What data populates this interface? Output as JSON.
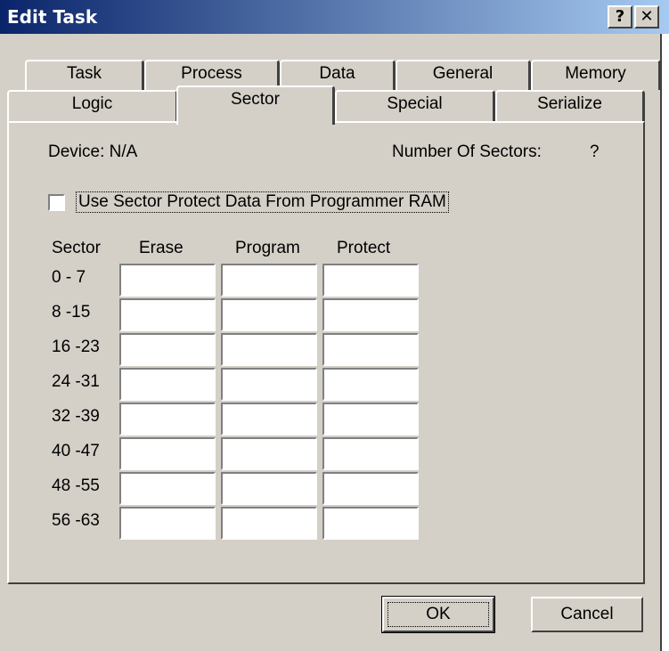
{
  "window": {
    "title": "Edit Task",
    "help_button": "?",
    "close_button": "✕",
    "title_gradient": [
      "#0a246a",
      "#a6caf0"
    ]
  },
  "tabs": {
    "row1": [
      "Task",
      "Process",
      "Data",
      "General",
      "Memory"
    ],
    "row2": [
      "Logic",
      "Sector",
      "Special",
      "Serialize"
    ],
    "active": "Sector"
  },
  "sector_panel": {
    "device_label": "Device: N/A",
    "num_sectors_label": "Number Of Sectors:",
    "num_sectors_value": "?",
    "use_protect_checkbox": {
      "label": "Use Sector Protect Data From Programmer RAM",
      "checked": false
    },
    "table": {
      "headers": [
        "Sector",
        "Erase",
        "Program",
        "Protect"
      ],
      "rows": [
        "0 - 7",
        "8 -15",
        "16 -23",
        "24 -31",
        "32 -39",
        "40 -47",
        "48 -55",
        "56 -63"
      ]
    }
  },
  "buttons": {
    "ok": "OK",
    "cancel": "Cancel"
  }
}
